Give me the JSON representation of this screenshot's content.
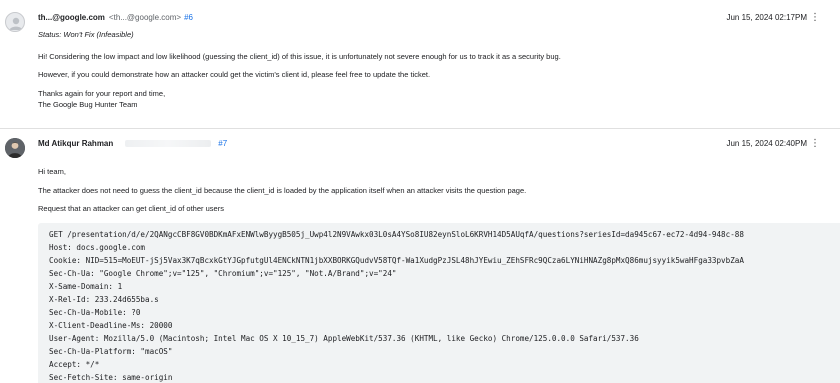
{
  "messages": [
    {
      "sender_name": "th...@google.com",
      "sender_email": "<th...@google.com>",
      "number": "#6",
      "date": "Jun 15, 2024 02:17PM",
      "more_icon": "⋮",
      "status": "Status: Won't Fix (Infeasible)",
      "body": [
        "Hi! Considering the low impact and low likelihood (guessing the client_id) of this issue, it is unfortunately not severe enough for us to track it as a security bug.",
        "However, if you could demonstrate how an attacker could get the victim's client id, please feel free to update the ticket.",
        "Thanks again for your report and time,",
        "The Google Bug Hunter Team"
      ]
    },
    {
      "sender_name": "Md Atikqur Rahman",
      "number": "#7",
      "date": "Jun 15, 2024 02:40PM",
      "more_icon": "⋮",
      "body": [
        "Hi team,",
        "The attacker does not need to guess the client_id because the client_id is loaded by the application itself when an attacker visits the question page.",
        "Request that an attacker can get client_id of other users"
      ],
      "code": [
        "GET /presentation/d/e/2QANgcCBF8GV0BDKmAFxENWlwByygB505j_Uwp4l2N9VAwkx03L0sA4YSo8IU82eynSloL6KRVH14D5AUqfA/questions?seriesId=da945c67-ec72-4d94-948c-88",
        "Host: docs.google.com",
        "Cookie: NID=515=MoEUT-jSj5Vax3K7qBcxkGtYJGpfutgUl4ENCkNTN1jbXXBORKGQudvV58TQf-Wa1XudgPzJSL48hJYEwiu_ZEhSFRc9QCza6LYNiHNAZg8pMxQ86mujsyyik5waHFga33pvbZaA",
        "Sec-Ch-Ua: \"Google Chrome\";v=\"125\", \"Chromium\";v=\"125\", \"Not.A/Brand\";v=\"24\"",
        "X-Same-Domain: 1",
        "X-Rel-Id: 233.24d655ba.s",
        "Sec-Ch-Ua-Mobile: ?0",
        "X-Client-Deadline-Ms: 20000",
        "User-Agent: Mozilla/5.0 (Macintosh; Intel Mac OS X 10_15_7) AppleWebKit/537.36 (KHTML, like Gecko) Chrome/125.0.0.0 Safari/537.36",
        "Sec-Ch-Ua-Platform: \"macOS\"",
        "Accept: */*",
        "Sec-Fetch-Site: same-origin"
      ]
    }
  ]
}
